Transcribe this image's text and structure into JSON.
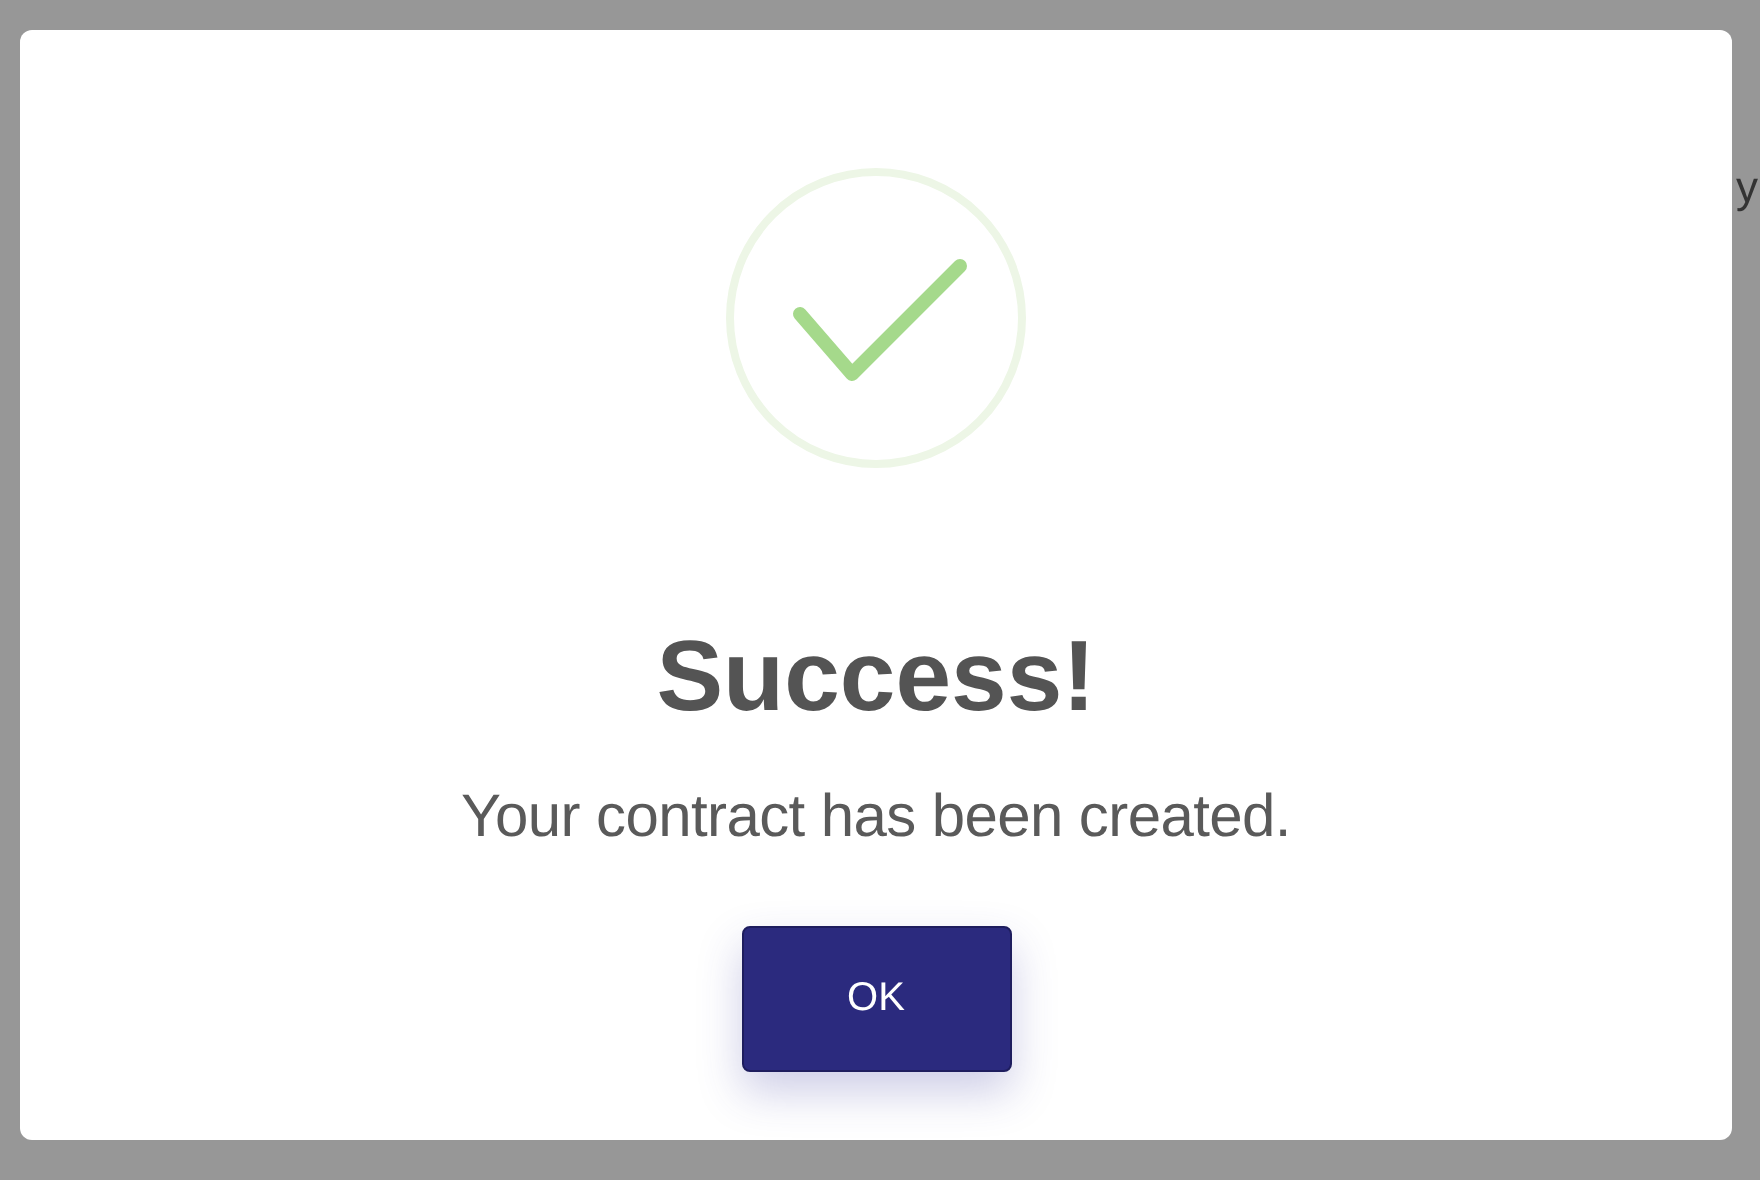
{
  "dialog": {
    "title": "Success!",
    "message": "Your contract has been created.",
    "button": "OK"
  },
  "background_text": "y"
}
